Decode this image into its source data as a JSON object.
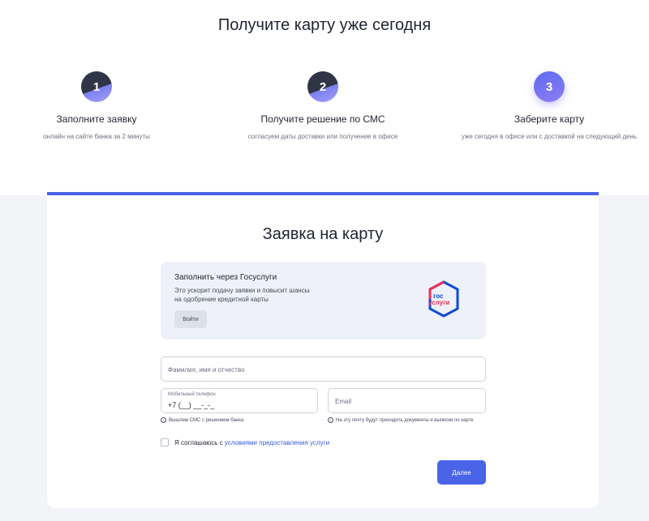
{
  "header": {
    "title": "Получите карту уже сегодня"
  },
  "steps": [
    {
      "number": "1",
      "title": "Заполните заявку",
      "subtitle": "онлайн на сайте банка за 2 минуты"
    },
    {
      "number": "2",
      "title": "Получите решение по СМС",
      "subtitle": "согласуем даты доставки или получение в офисе"
    },
    {
      "number": "3",
      "title": "Заберите карту",
      "subtitle": "уже сегодня в офисе или с доставкой на следующий день"
    }
  ],
  "form": {
    "title": "Заявка на карту",
    "gosuslugi": {
      "title": "Заполнить через Госуслуги",
      "description": "Это ускорит подачу заявки и повысит шансы на одобрение кредитной карты",
      "button_label": "Войти",
      "logo_text_top": "гос",
      "logo_text_bottom": "услуги"
    },
    "fio_placeholder": "Фамилия, имя и отчество",
    "phone_label": "Мобильный телефон",
    "phone_value": "+7 (__) __-_-_",
    "email_placeholder": "Email",
    "phone_hint": "Вышлем СМС с решением банка",
    "email_hint": "На эту почту будут приходить документы и выписки по карте",
    "agree_text": "Я соглашаюсь с",
    "agree_link": "условиями предоставления услуги",
    "next_button": "Далее"
  },
  "colors": {
    "accent": "#4a64e8",
    "link": "#3b5bdb",
    "panel": "#eef1fa",
    "background": "#f2f4f8"
  }
}
